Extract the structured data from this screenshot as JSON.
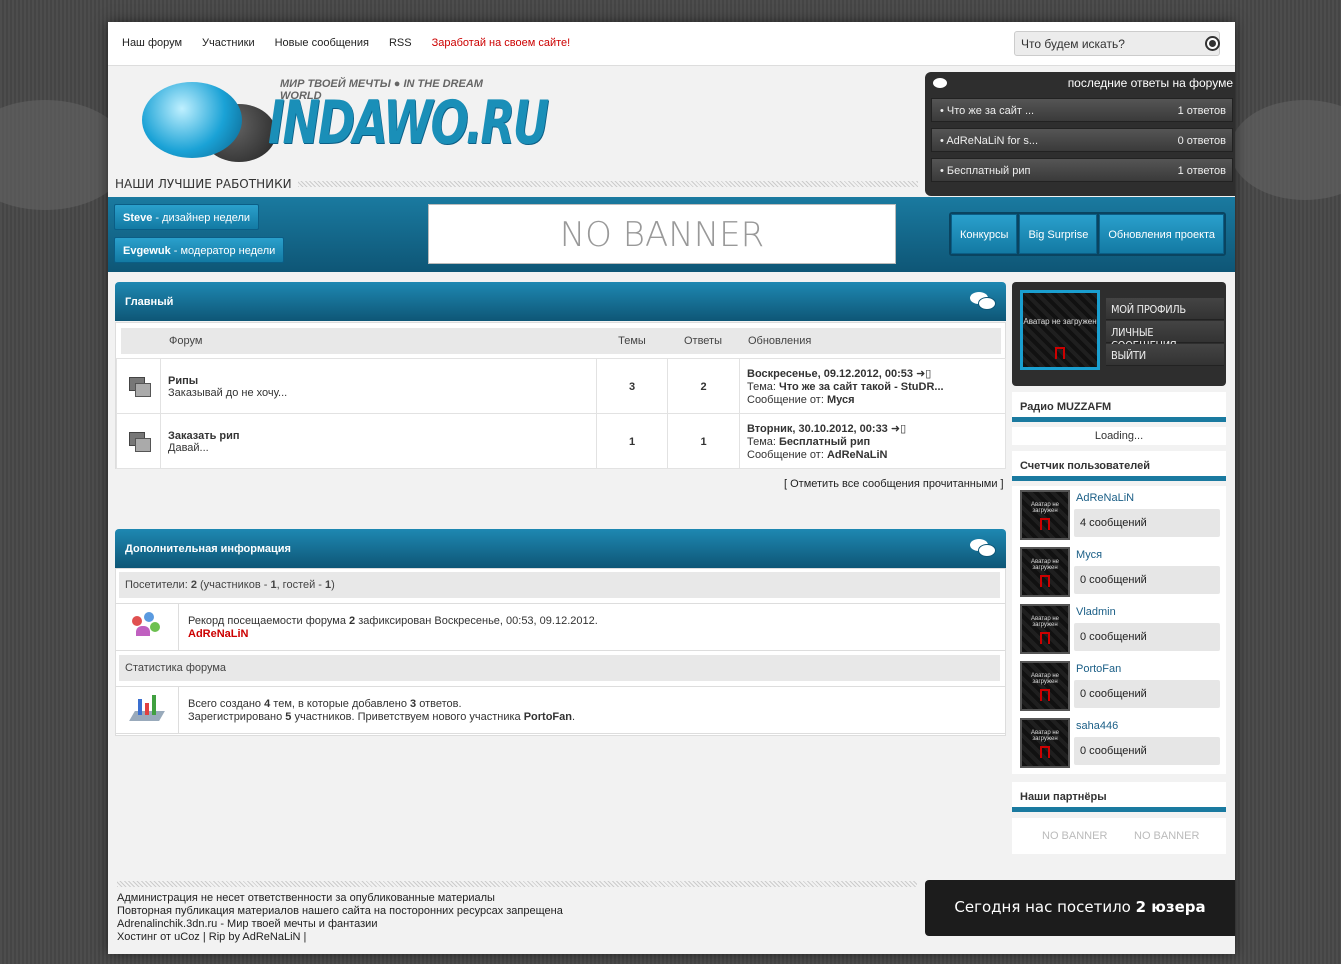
{
  "nav": [
    "Наш форум",
    "Участники",
    "Новые сообщения",
    "RSS",
    "Заработай на своем сайте!"
  ],
  "search": {
    "placeholder": "Что будем искать?"
  },
  "logo": {
    "text": "INDAWO.RU",
    "tagline": "МИР ТВОЕЙ МЕЧТЫ ● IN THE DREAM WORLD"
  },
  "workers_heading": "НАШИ ЛУЧШИЕ РАБОТНИКИ",
  "workers": [
    {
      "name": "Steve",
      "role": " - дизайнер недели"
    },
    {
      "name": "Evgewuk",
      "role": " - модератор недели"
    }
  ],
  "banner": "NO BANNER",
  "tabs": [
    "Конкурсы",
    "Big Surprise",
    "Обновления проекта"
  ],
  "last_answers": {
    "title": "последние ответы на форуме",
    "items": [
      {
        "topic": "Что же за сайт ...",
        "count": "1 ответов"
      },
      {
        "topic": "AdReNaLiN for s...",
        "count": "0 ответов"
      },
      {
        "topic": "Бесплатный рип",
        "count": "1 ответов"
      }
    ]
  },
  "main": {
    "title": "Главный",
    "headers": {
      "forum": "Форум",
      "topics": "Темы",
      "replies": "Ответы",
      "updates": "Обновления"
    },
    "rows": [
      {
        "name": "Рипы",
        "desc": "Заказывай до не хочу...",
        "topics": "3",
        "replies": "2",
        "date": "Воскресенье, 09.12.2012, 00:53",
        "topic_label": "Тема: ",
        "topic": "Что же за сайт такой - StuDR...",
        "from_label": "Сообщение от: ",
        "author": "Муся"
      },
      {
        "name": "Заказать рип",
        "desc": "Давай...",
        "topics": "1",
        "replies": "1",
        "date": "Вторник, 30.10.2012, 00:33",
        "topic_label": "Тема: ",
        "topic": "Бесплатный рип",
        "from_label": "Сообщение от: ",
        "author": "AdReNaLiN"
      }
    ],
    "mark_read": "[ Отметить все сообщения прочитанными ]"
  },
  "info": {
    "title": "Дополнительная информация",
    "visitors_prefix": "Посетители: ",
    "visitors_total": "2",
    "visitors_members_prefix": "  (участников - ",
    "visitors_members": "1",
    "visitors_guests_prefix": ", гостей - ",
    "visitors_guests": "1",
    "visitors_suffix": ")",
    "record_prefix": "Рекорд посещаемости форума ",
    "record_count": "2",
    "record_suffix": " зафиксирован Воскресенье, 00:53, 09.12.2012.",
    "record_user": "AdReNaLiN",
    "stats_title": "Статистика форума",
    "stats_line1_a": "Всего создано ",
    "stats_topics": "4",
    "stats_line1_b": " тем, в которые добавлено ",
    "stats_replies": "3",
    "stats_line1_c": " ответов.",
    "stats_line2_a": "Зарегистрировано ",
    "stats_members": "5",
    "stats_line2_b": " участников. Приветствуем нового участника ",
    "stats_newest": "PortoFan",
    "stats_line2_c": "."
  },
  "profile": {
    "avatar_text": "Аватар не загружен",
    "links": [
      "МОЙ ПРОФИЛЬ",
      "ЛИЧНЫЕ СООБЩЕНИЯ",
      "ВЫЙТИ"
    ]
  },
  "radio": {
    "title": "Радио MUZZAFM",
    "status": "Loading..."
  },
  "counter": {
    "title": "Счетчик пользователей",
    "users": [
      {
        "name": "AdReNaLiN",
        "msgs": "4 сообщений"
      },
      {
        "name": "Муся",
        "msgs": "0 сообщений"
      },
      {
        "name": "Vladmin",
        "msgs": "0 сообщений"
      },
      {
        "name": "PortoFan",
        "msgs": "0 сообщений"
      },
      {
        "name": "saha446",
        "msgs": "0 сообщений"
      }
    ]
  },
  "partners": {
    "title": "Наши партнёры",
    "banners": [
      "NO BANNER",
      "NO BANNER"
    ]
  },
  "footer": [
    "Администрация не несет ответственности за опубликованные материалы",
    "Повторная публикация материалов нашего сайта на посторонних ресурсах запрещена",
    "Adrenalinchik.3dn.ru - Мир твоей мечты и фантазии",
    "Хостинг от uCoz | Rip by AdReNaLiN |"
  ],
  "visits": {
    "prefix": "Сегодня нас посетило ",
    "count": "2 юзера"
  }
}
